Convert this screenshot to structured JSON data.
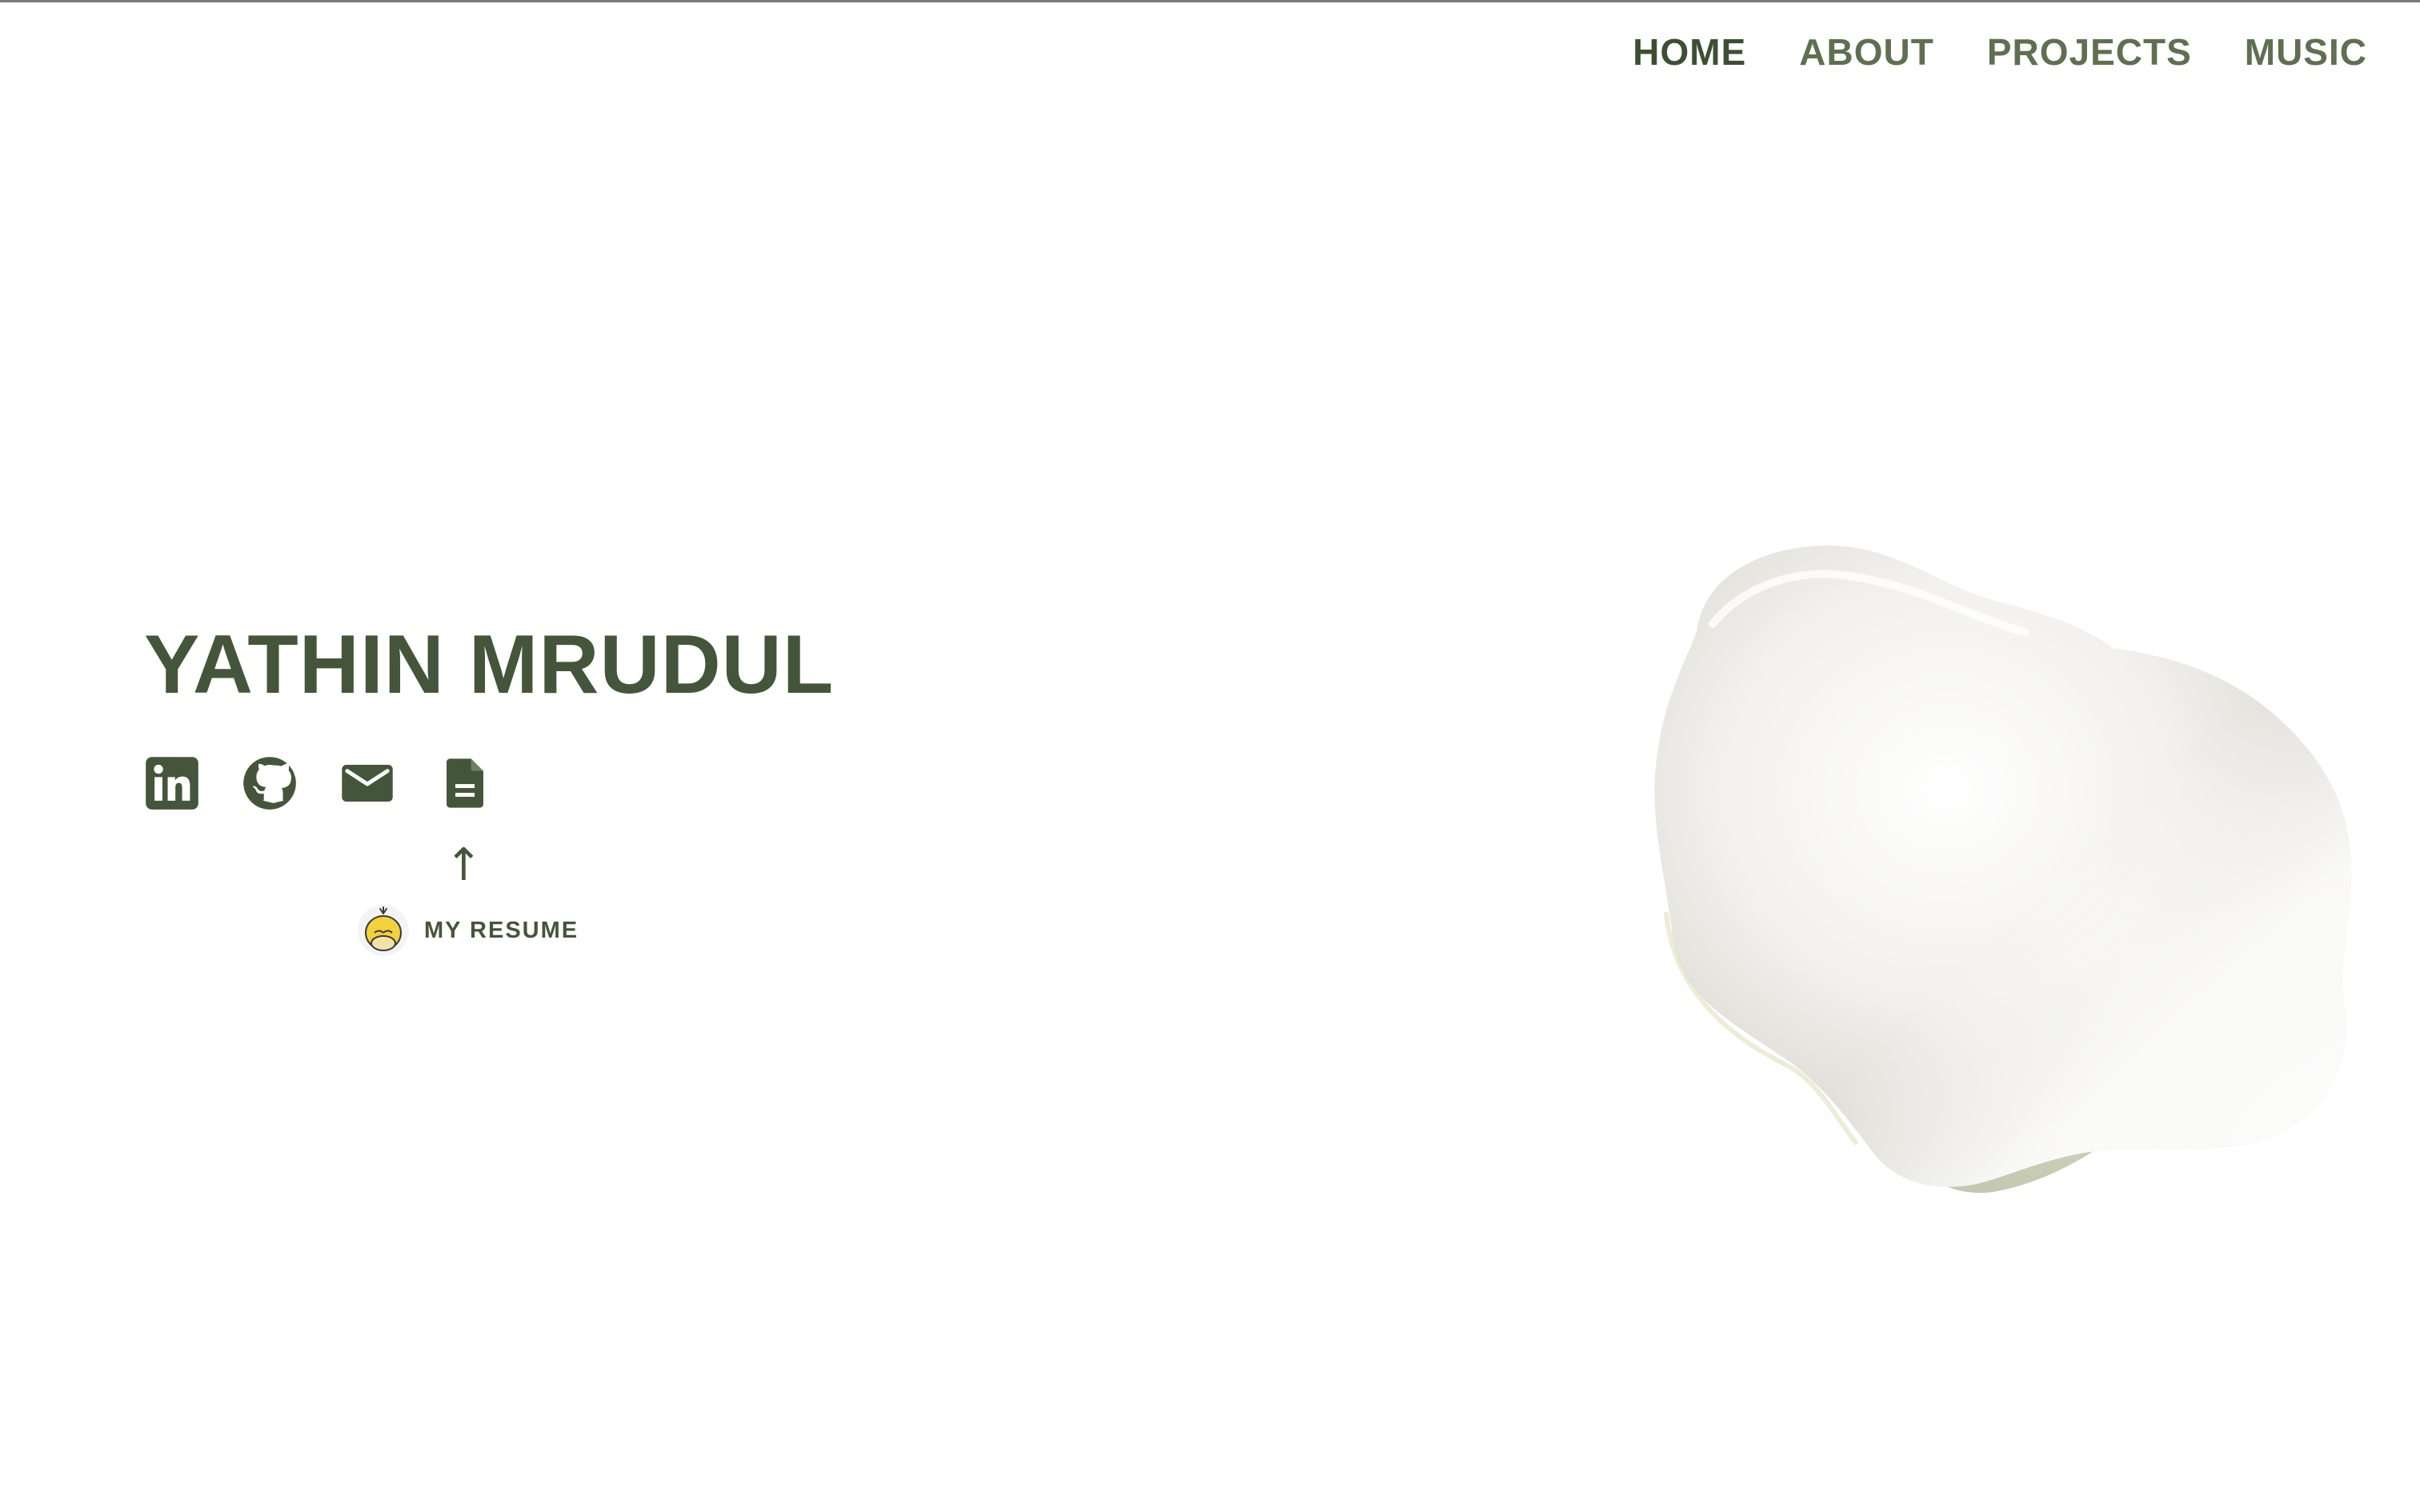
{
  "nav": {
    "items": [
      {
        "label": "HOME",
        "active": true
      },
      {
        "label": "ABOUT",
        "active": false
      },
      {
        "label": "PROJECTS",
        "active": false
      },
      {
        "label": "MUSIC",
        "active": false
      }
    ]
  },
  "hero": {
    "name": "YATHIN MRUDUL"
  },
  "social": {
    "icons": [
      "linkedin-icon",
      "github-icon",
      "mail-icon",
      "document-icon"
    ]
  },
  "resume_hint": {
    "arrow": "↑",
    "label": "MY RESUME"
  },
  "colors": {
    "accent": "#44563a",
    "nav_inactive": "#5e7050",
    "background": "#ffffff"
  }
}
